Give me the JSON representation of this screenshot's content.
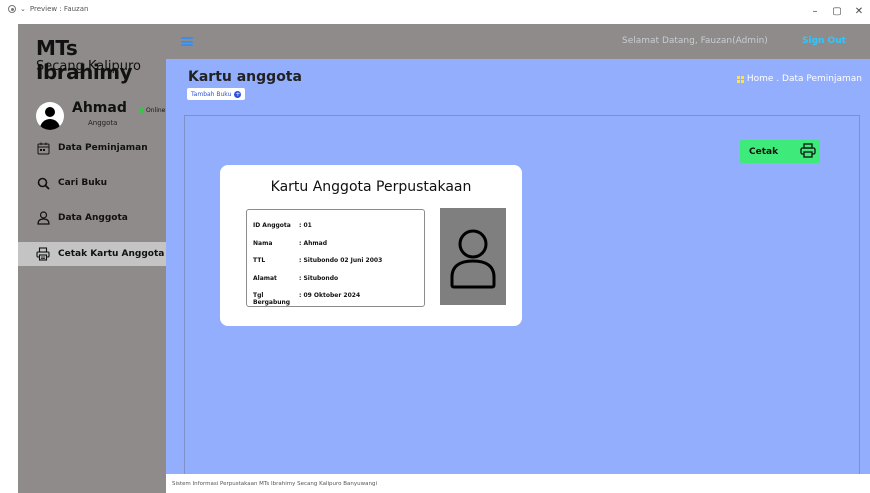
{
  "window": {
    "title": "Preview : Fauzan",
    "minimize_glyph": "–",
    "restore_glyph": "▢",
    "close_glyph": "✕"
  },
  "sidebar": {
    "brand": "MTs Ibrahimy",
    "brand_sub": "Secang Kalipuro",
    "user": {
      "name": "Ahmad",
      "status": "Online",
      "role": "Anggota"
    },
    "items": [
      {
        "label": "Data Peminjaman",
        "icon": "calendar-icon"
      },
      {
        "label": "Cari Buku",
        "icon": "search-icon"
      },
      {
        "label": "Data Anggota",
        "icon": "user-icon"
      },
      {
        "label": "Cetak Kartu Anggota",
        "icon": "printer-icon",
        "active": true
      }
    ]
  },
  "header": {
    "welcome": "Selamat Datang, Fauzan(Admin)",
    "signout": "Sign Out"
  },
  "main": {
    "title": "Kartu anggota",
    "tambah_label": "Tambah Buku",
    "breadcrumb": "Home . Data Peminjaman",
    "cetak_label": "Cetak",
    "card": {
      "title": "Kartu Anggota Perpustakaan",
      "rows": [
        {
          "key": "ID Anggota",
          "value": ": 01"
        },
        {
          "key": "Nama",
          "value": ": Ahmad"
        },
        {
          "key": "TTL",
          "value": ": Situbondo 02 Juni 2003"
        },
        {
          "key": "Alamat",
          "value": ": Situbondo"
        },
        {
          "key": "Tgl Bergabung",
          "value": ": 09 Oktober 2024"
        }
      ]
    }
  },
  "footer": {
    "text": "Sistem Informasi Perpustakaan MTs Ibrahimy Secang Kalipuro Banyuwangi"
  },
  "colors": {
    "sidebar_bg": "#8f8b8b",
    "content_bg": "#93aefc",
    "cetak_bg": "#3eea7a",
    "signout": "#2ec8ff",
    "active_item": "#c4c4c4"
  }
}
